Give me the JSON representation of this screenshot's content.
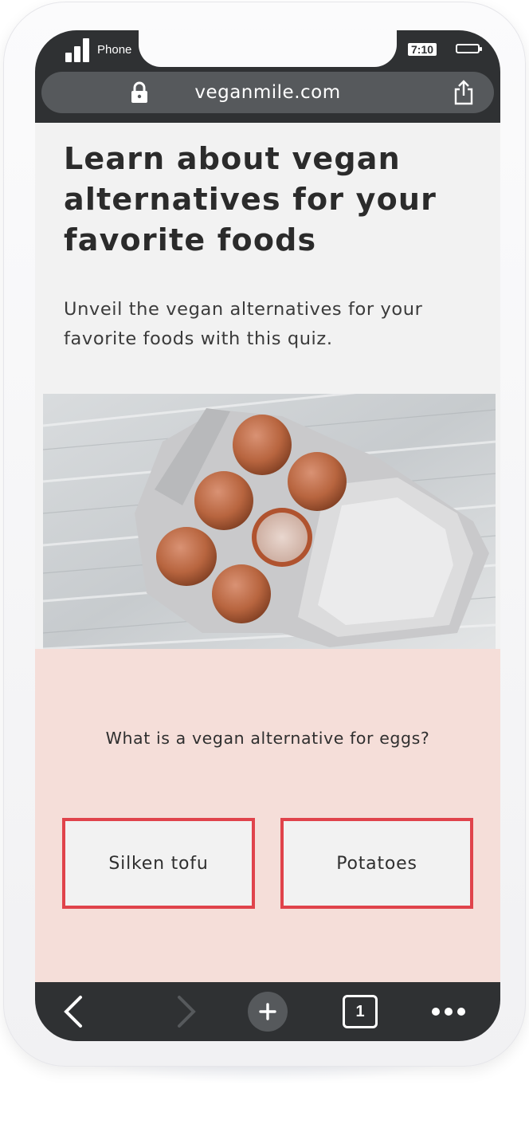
{
  "status_bar": {
    "carrier": "Phone",
    "time": "7:10",
    "icons": [
      "signal-icon",
      "battery-icon"
    ]
  },
  "browser": {
    "url": "veganmile.com",
    "icons": [
      "lock-icon",
      "share-icon"
    ]
  },
  "page": {
    "title": "Learn about vegan alternatives for your favorite foods",
    "subtitle": "Unveil the vegan alternatives for your favorite foods with this quiz.",
    "image": "eggs-in-carton"
  },
  "quiz": {
    "question": "What is a vegan alternative for eggs?",
    "answers": [
      "Silken tofu",
      "Potatoes"
    ]
  },
  "toolbar": {
    "tab_count": "1",
    "icons": [
      "back-icon",
      "forward-icon",
      "new-tab-icon",
      "tabs-icon",
      "more-icon"
    ]
  },
  "colors": {
    "chrome_dark": "#2f3133",
    "quiz_background": "#f5ded9",
    "answer_border": "#e0434b",
    "page_background": "#f2f2f2"
  }
}
